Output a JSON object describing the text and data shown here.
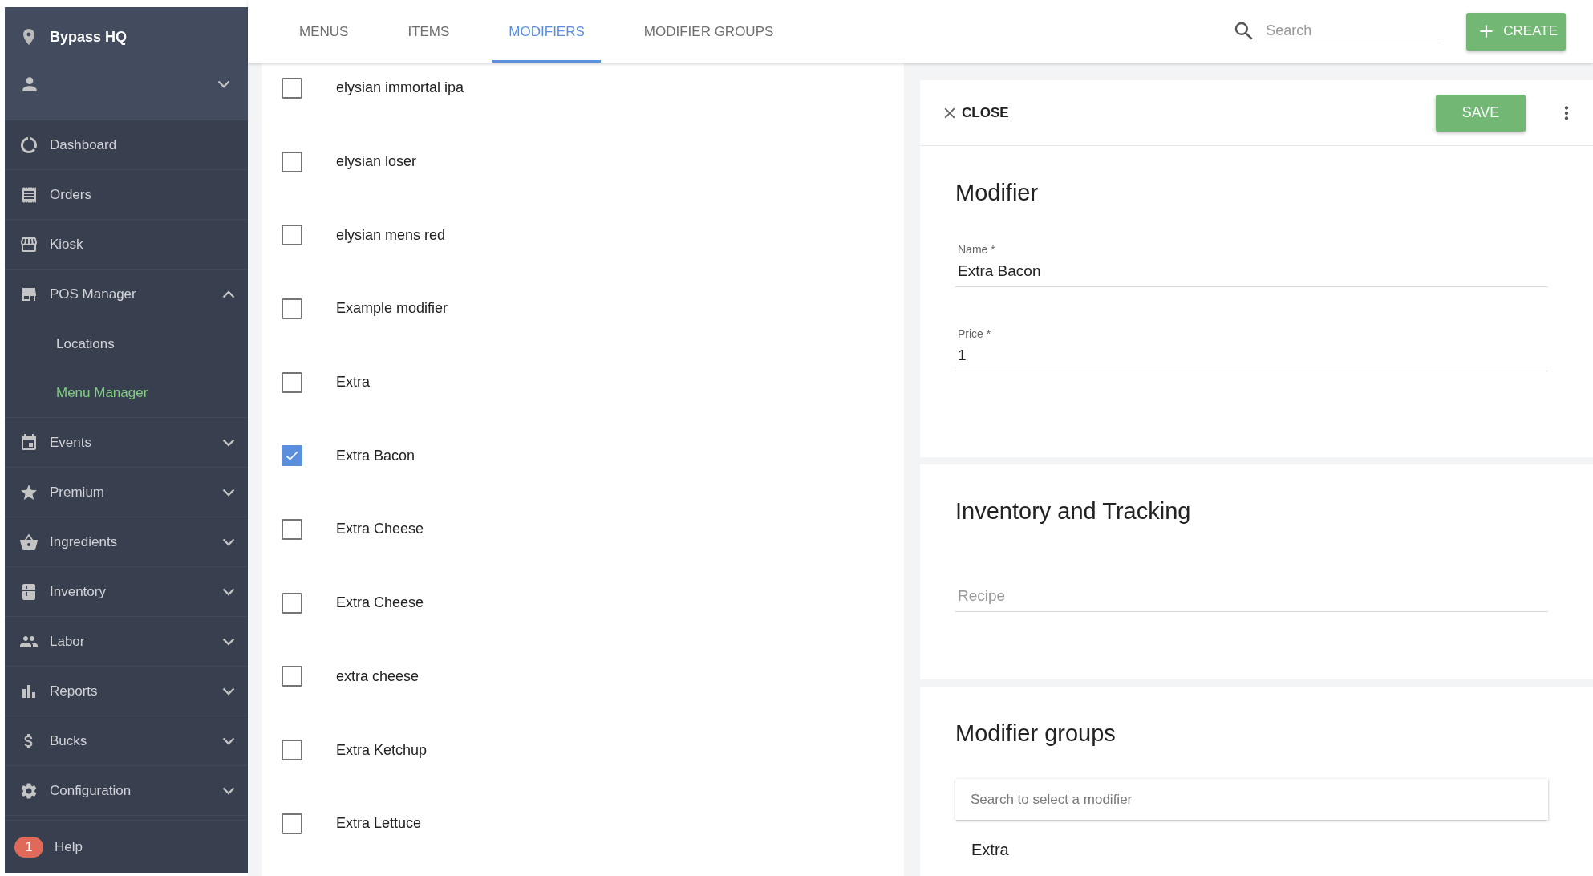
{
  "sidebar": {
    "location": "Bypass HQ",
    "nav": [
      {
        "label": "Dashboard",
        "kind": "link"
      },
      {
        "label": "Orders",
        "kind": "link"
      },
      {
        "label": "Kiosk",
        "kind": "link"
      },
      {
        "label": "POS Manager",
        "kind": "group",
        "expanded": true,
        "children": [
          {
            "label": "Locations",
            "selected": false
          },
          {
            "label": "Menu Manager",
            "selected": true
          }
        ]
      },
      {
        "label": "Events",
        "kind": "group",
        "expanded": false
      },
      {
        "label": "Premium",
        "kind": "group",
        "expanded": false
      },
      {
        "label": "Ingredients",
        "kind": "group",
        "expanded": false
      },
      {
        "label": "Inventory",
        "kind": "group",
        "expanded": false
      },
      {
        "label": "Labor",
        "kind": "group",
        "expanded": false
      },
      {
        "label": "Reports",
        "kind": "group",
        "expanded": false
      },
      {
        "label": "Bucks",
        "kind": "group",
        "expanded": false
      },
      {
        "label": "Configuration",
        "kind": "group",
        "expanded": false
      }
    ],
    "help": {
      "label": "Help",
      "badge": "1"
    }
  },
  "tabs": [
    {
      "label": "MENUS",
      "selected": false
    },
    {
      "label": "ITEMS",
      "selected": false
    },
    {
      "label": "MODIFIERS",
      "selected": true
    },
    {
      "label": "MODIFIER GROUPS",
      "selected": false
    }
  ],
  "search": {
    "placeholder": "Search"
  },
  "create_button": "CREATE",
  "modifiers": [
    {
      "label": "elysian immortal ipa",
      "checked": false
    },
    {
      "label": "elysian loser",
      "checked": false
    },
    {
      "label": "elysian mens red",
      "checked": false
    },
    {
      "label": "Example modifier",
      "checked": false
    },
    {
      "label": "Extra",
      "checked": false
    },
    {
      "label": "Extra Bacon",
      "checked": true
    },
    {
      "label": "Extra Cheese",
      "checked": false
    },
    {
      "label": "Extra Cheese",
      "checked": false
    },
    {
      "label": "extra cheese",
      "checked": false
    },
    {
      "label": "Extra Ketchup",
      "checked": false
    },
    {
      "label": "Extra Lettuce",
      "checked": false
    }
  ],
  "detail": {
    "close": "CLOSE",
    "save": "SAVE",
    "title": "Modifier",
    "fields": [
      {
        "label": "Name *",
        "value": "Extra Bacon"
      },
      {
        "label": "Price *",
        "value": "1"
      }
    ],
    "inventory": {
      "title": "Inventory and Tracking",
      "recipe": {
        "placeholder": "Recipe"
      }
    },
    "groups": {
      "title": "Modifier groups",
      "search": {
        "placeholder": "Search to select a modifier"
      },
      "items": [
        {
          "name": "Extra"
        }
      ]
    }
  }
}
